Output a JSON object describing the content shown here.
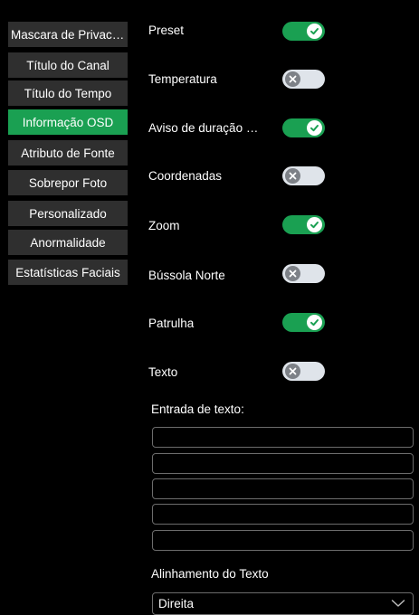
{
  "sidebar": {
    "items": [
      {
        "label": "Mascara de Privacidade",
        "active": false
      },
      {
        "label": "Título do Canal",
        "active": false
      },
      {
        "label": "Título do Tempo",
        "active": false
      },
      {
        "label": "Informação OSD",
        "active": true
      },
      {
        "label": "Atributo de Fonte",
        "active": false
      },
      {
        "label": "Sobrepor Foto",
        "active": false
      },
      {
        "label": "Personalizado",
        "active": false
      },
      {
        "label": "Anormalidade",
        "active": false
      },
      {
        "label": "Estatísticas Faciais",
        "active": false
      }
    ]
  },
  "osd": {
    "rows": [
      {
        "label": "Preset",
        "enabled": true
      },
      {
        "label": "Temperatura",
        "enabled": false
      },
      {
        "label": "Aviso de duração de PTZ",
        "enabled": true
      },
      {
        "label": "Coordenadas",
        "enabled": false
      },
      {
        "label": "Zoom",
        "enabled": true
      },
      {
        "label": "Bússola Norte",
        "enabled": false
      },
      {
        "label": "Patrulha",
        "enabled": true
      },
      {
        "label": "Texto",
        "enabled": false
      }
    ],
    "text_input_label": "Entrada de texto:",
    "text_inputs": [
      "",
      "",
      "",
      "",
      ""
    ],
    "alignment_label": "Alinhamento do Texto",
    "alignment_value": "Direita"
  },
  "colors": {
    "accent": "#1aa052",
    "nav_bg": "#2f2f2f",
    "toggle_off_track": "#dfe4ea",
    "toggle_off_knob": "#7d8187"
  },
  "icons": {
    "toggle_on": "check-icon",
    "toggle_off": "x-icon",
    "select": "chevron-down-icon"
  }
}
